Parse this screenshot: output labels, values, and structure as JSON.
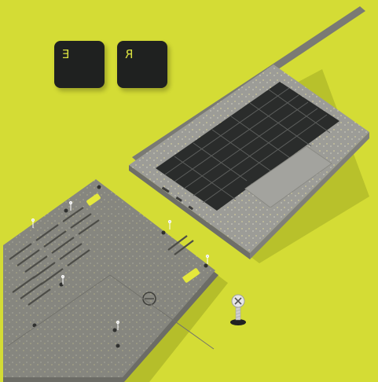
{
  "keycaps": [
    {
      "legend": "E"
    },
    {
      "legend": "R"
    }
  ],
  "colors": {
    "background": "#d4dc35",
    "laptop_shell": "#9a9a96",
    "keycap": "#1f2120",
    "accent_yellow": "#d8e040"
  },
  "icons": [
    "laptop-open",
    "laptop-underside",
    "screw-icon"
  ]
}
